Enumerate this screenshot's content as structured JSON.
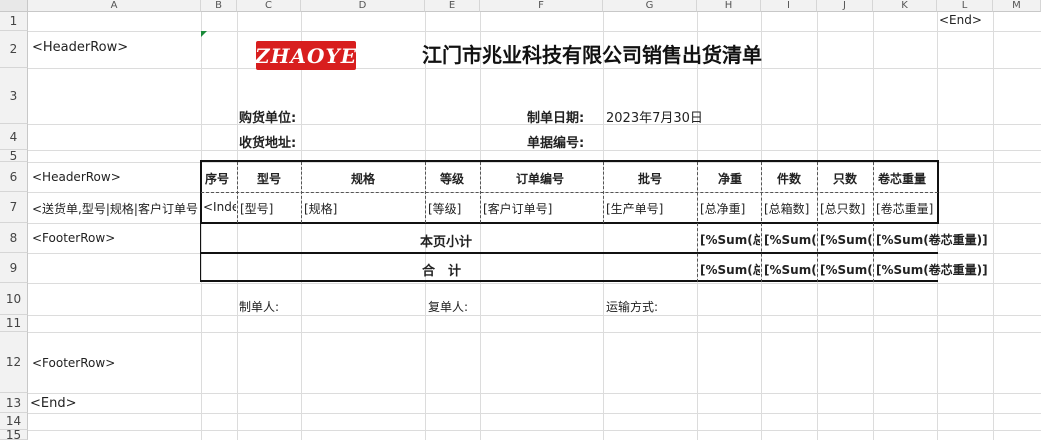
{
  "columns": [
    "A",
    "B",
    "C",
    "D",
    "E",
    "F",
    "G",
    "H",
    "I",
    "J",
    "K",
    "L",
    "M"
  ],
  "rows": [
    "1",
    "2",
    "3",
    "4",
    "5",
    "6",
    "7",
    "8",
    "9",
    "10",
    "11",
    "12",
    "13",
    "14",
    "15"
  ],
  "cells": {
    "l1": "<End>",
    "a2": "<HeaderRow>",
    "logo_text": "ZHAOYE",
    "title": "江门市兆业科技有限公司销售出货清单",
    "buyer_label": "购货单位:",
    "date_label": "制单日期:",
    "date_value": "2023年7月30日",
    "address_label": "收货地址:",
    "doc_no_label": "单据编号:",
    "a6": "<HeaderRow>",
    "a7": "<送货单,型号|规格|客户订单号",
    "a8": "<FooterRow>",
    "a12": "<FooterRow>",
    "a13": "<End>",
    "preparer_label": "制单人:",
    "reviewer_label": "复单人:",
    "shipping_label": "运输方式:"
  },
  "table": {
    "headers": [
      "序号",
      "型号",
      "规格",
      "等级",
      "订单编号",
      "批号",
      "净重",
      "件数",
      "只数",
      "卷芯重量"
    ],
    "template_row": [
      "<Inde",
      "[型号]",
      "[规格]",
      "[等级]",
      "[客户订单号]",
      "[生产单号]",
      "[总净重]",
      "[总箱数]",
      "[总只数]",
      "[卷芯重量]"
    ],
    "subtotal_label": "本页小计",
    "total_label": "合　计",
    "sum_cells": [
      "[%Sum(总净",
      "[%Sum(总",
      "[%Sum(总",
      "[%Sum(卷芯重量)]"
    ]
  }
}
